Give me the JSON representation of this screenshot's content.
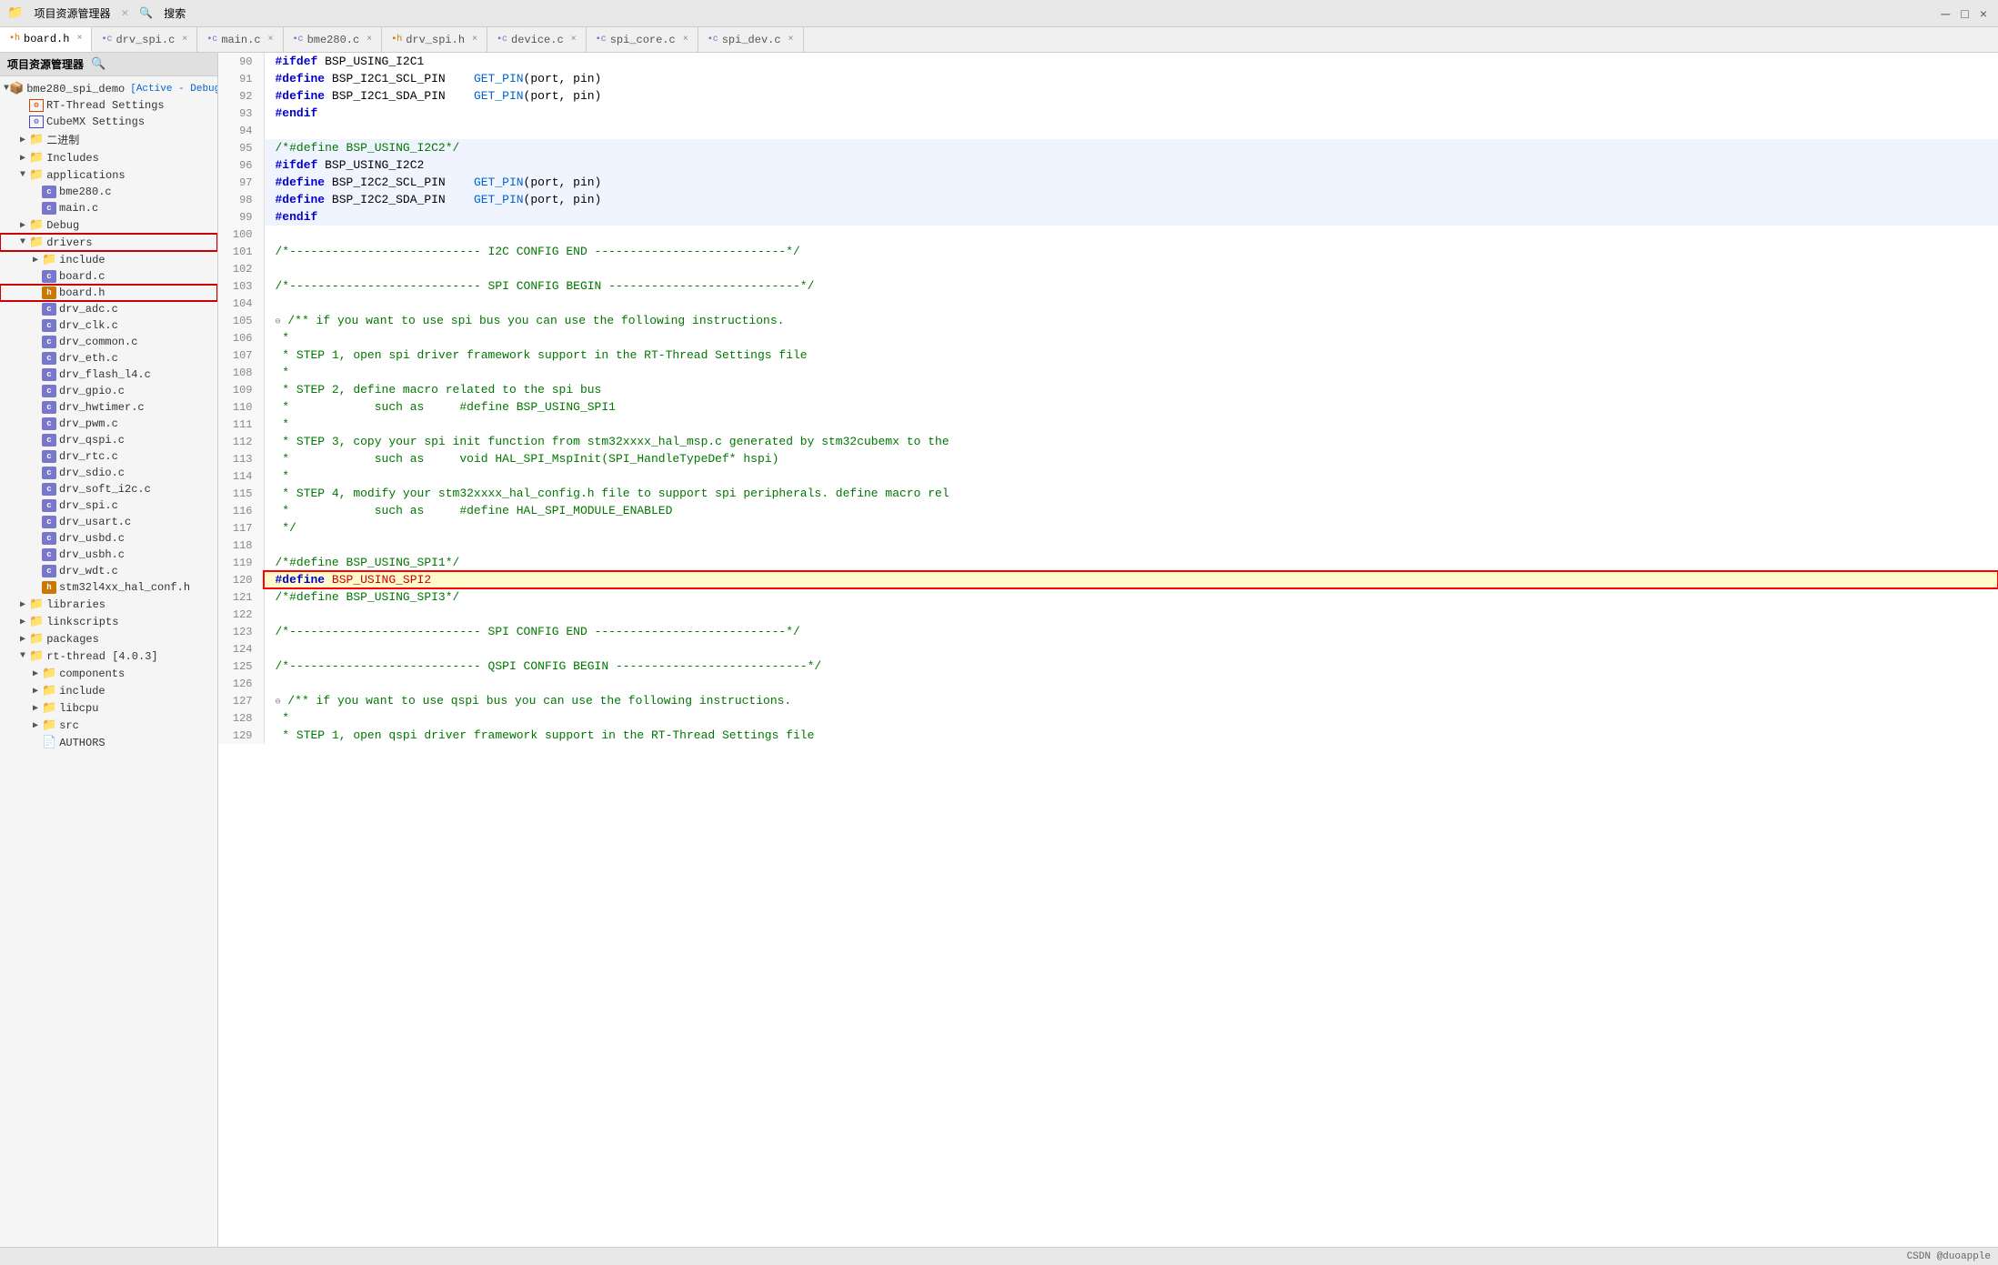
{
  "topbar": {
    "title": "项目资源管理器",
    "search": "搜索",
    "minimize": "─",
    "restore": "□",
    "close": "×",
    "window_controls": [
      "─",
      "□",
      "×"
    ]
  },
  "tabs": [
    {
      "id": "board_h",
      "label": "board.h",
      "icon": "h",
      "active": true,
      "closable": true
    },
    {
      "id": "drv_spi_c",
      "label": "drv_spi.c",
      "icon": "c",
      "active": false,
      "closable": true
    },
    {
      "id": "main_c",
      "label": "main.c",
      "icon": "c",
      "active": false,
      "closable": true
    },
    {
      "id": "bme280_c",
      "label": "bme280.c",
      "icon": "c",
      "active": false,
      "closable": true
    },
    {
      "id": "drv_spi_h",
      "label": "drv_spi.h",
      "icon": "h",
      "active": false,
      "closable": true
    },
    {
      "id": "device_c",
      "label": "device.c",
      "icon": "c",
      "active": false,
      "closable": true
    },
    {
      "id": "spi_core_c",
      "label": "spi_core.c",
      "icon": "c",
      "active": false,
      "closable": true
    },
    {
      "id": "spi_dev_c",
      "label": "spi_dev.c",
      "icon": "c",
      "active": false,
      "closable": true
    }
  ],
  "sidebar": {
    "title": "项目资源管理器",
    "search_label": "搜索",
    "tree": [
      {
        "id": "root",
        "label": "bme280_spi_demo",
        "badge": "[Active - Debug]",
        "level": 0,
        "type": "project",
        "expanded": true
      },
      {
        "id": "rt_settings",
        "label": "RT-Thread Settings",
        "level": 1,
        "type": "settings",
        "icon": "RT"
      },
      {
        "id": "cubemx",
        "label": "CubeMX Settings",
        "level": 1,
        "type": "settings",
        "icon": "MX"
      },
      {
        "id": "binary",
        "label": "二进制",
        "level": 1,
        "type": "folder",
        "expanded": false
      },
      {
        "id": "includes",
        "label": "Includes",
        "level": 1,
        "type": "folder",
        "expanded": false
      },
      {
        "id": "applications",
        "label": "applications",
        "level": 1,
        "type": "folder",
        "expanded": true
      },
      {
        "id": "bme280_c",
        "label": "bme280.c",
        "level": 2,
        "type": "c_file"
      },
      {
        "id": "main_c",
        "label": "main.c",
        "level": 2,
        "type": "c_file"
      },
      {
        "id": "debug",
        "label": "Debug",
        "level": 1,
        "type": "folder",
        "expanded": false
      },
      {
        "id": "drivers",
        "label": "drivers",
        "level": 1,
        "type": "folder",
        "expanded": true,
        "highlighted": true
      },
      {
        "id": "include_folder",
        "label": "include",
        "level": 2,
        "type": "folder",
        "expanded": false
      },
      {
        "id": "board_c",
        "label": "board.c",
        "level": 2,
        "type": "c_file"
      },
      {
        "id": "board_h",
        "label": "board.h",
        "level": 2,
        "type": "h_file",
        "highlighted": true
      },
      {
        "id": "drv_adc_c",
        "label": "drv_adc.c",
        "level": 2,
        "type": "c_file"
      },
      {
        "id": "drv_clk_c",
        "label": "drv_clk.c",
        "level": 2,
        "type": "c_file"
      },
      {
        "id": "drv_common_c",
        "label": "drv_common.c",
        "level": 2,
        "type": "c_file"
      },
      {
        "id": "drv_eth_c",
        "label": "drv_eth.c",
        "level": 2,
        "type": "c_file"
      },
      {
        "id": "drv_flash_l4_c",
        "label": "drv_flash_l4.c",
        "level": 2,
        "type": "c_file"
      },
      {
        "id": "drv_gpio_c",
        "label": "drv_gpio.c",
        "level": 2,
        "type": "c_file"
      },
      {
        "id": "drv_hwtimer_c",
        "label": "drv_hwtimer.c",
        "level": 2,
        "type": "c_file"
      },
      {
        "id": "drv_pwm_c",
        "label": "drv_pwm.c",
        "level": 2,
        "type": "c_file"
      },
      {
        "id": "drv_qspi_c",
        "label": "drv_qspi.c",
        "level": 2,
        "type": "c_file"
      },
      {
        "id": "drv_rtc_c",
        "label": "drv_rtc.c",
        "level": 2,
        "type": "c_file"
      },
      {
        "id": "drv_sdio_c",
        "label": "drv_sdio.c",
        "level": 2,
        "type": "c_file"
      },
      {
        "id": "drv_soft_i2c_c",
        "label": "drv_soft_i2c.c",
        "level": 2,
        "type": "c_file"
      },
      {
        "id": "drv_spi_c",
        "label": "drv_spi.c",
        "level": 2,
        "type": "c_file"
      },
      {
        "id": "drv_usart_c",
        "label": "drv_usart.c",
        "level": 2,
        "type": "c_file"
      },
      {
        "id": "drv_usbd_c",
        "label": "drv_usbd.c",
        "level": 2,
        "type": "c_file"
      },
      {
        "id": "drv_usbh_c",
        "label": "drv_usbh.c",
        "level": 2,
        "type": "c_file"
      },
      {
        "id": "drv_wdt_c",
        "label": "drv_wdt.c",
        "level": 2,
        "type": "c_file"
      },
      {
        "id": "stm32l4xx_hal_conf_h",
        "label": "stm32l4xx_hal_conf.h",
        "level": 2,
        "type": "h_file"
      },
      {
        "id": "libraries",
        "label": "libraries",
        "level": 1,
        "type": "folder",
        "expanded": false
      },
      {
        "id": "linkscripts",
        "label": "linkscripts",
        "level": 1,
        "type": "folder",
        "expanded": false
      },
      {
        "id": "packages",
        "label": "packages",
        "level": 1,
        "type": "folder",
        "expanded": false
      },
      {
        "id": "rt_thread",
        "label": "rt-thread [4.0.3]",
        "level": 1,
        "type": "folder",
        "expanded": true
      },
      {
        "id": "components",
        "label": "components",
        "level": 2,
        "type": "folder",
        "expanded": false
      },
      {
        "id": "include_rt",
        "label": "include",
        "level": 2,
        "type": "folder",
        "expanded": false
      },
      {
        "id": "libcpu",
        "label": "libcpu",
        "level": 2,
        "type": "folder",
        "expanded": false
      },
      {
        "id": "src",
        "label": "src",
        "level": 2,
        "type": "folder",
        "expanded": false
      },
      {
        "id": "authors",
        "label": "AUTHORS",
        "level": 2,
        "type": "file"
      }
    ]
  },
  "code": {
    "lines": [
      {
        "num": 90,
        "content": "#ifdef BSP_USING_I2C1",
        "type": "pp"
      },
      {
        "num": 91,
        "content": "#define BSP_I2C1_SCL_PIN    GET_PIN(port, pin)",
        "type": "pp"
      },
      {
        "num": 92,
        "content": "#define BSP_I2C1_SDA_PIN    GET_PIN(port, pin)",
        "type": "pp"
      },
      {
        "num": 93,
        "content": "#endif",
        "type": "pp"
      },
      {
        "num": 94,
        "content": "",
        "type": "blank"
      },
      {
        "num": 95,
        "content": "/*#define BSP_USING_I2C2*/",
        "type": "comment_pp"
      },
      {
        "num": 96,
        "content": "#ifdef BSP_USING_I2C2",
        "type": "pp"
      },
      {
        "num": 97,
        "content": "#define BSP_I2C2_SCL_PIN    GET_PIN(port, pin)",
        "type": "pp"
      },
      {
        "num": 98,
        "content": "#define BSP_I2C2_SDA_PIN    GET_PIN(port, pin)",
        "type": "pp"
      },
      {
        "num": 99,
        "content": "#endif",
        "type": "pp"
      },
      {
        "num": 100,
        "content": "",
        "type": "blank"
      },
      {
        "num": 101,
        "content": "/*--------------------------- I2C CONFIG END ---------------------------*/",
        "type": "comment"
      },
      {
        "num": 102,
        "content": "",
        "type": "blank"
      },
      {
        "num": 103,
        "content": "/*--------------------------- SPI CONFIG BEGIN ---------------------------*/",
        "type": "comment"
      },
      {
        "num": 104,
        "content": "",
        "type": "blank"
      },
      {
        "num": 105,
        "content": "/** if you want to use spi bus you can use the following instructions.",
        "type": "comment_fold"
      },
      {
        "num": 106,
        "content": " *",
        "type": "comment"
      },
      {
        "num": 107,
        "content": " * STEP 1, open spi driver framework support in the RT-Thread Settings file",
        "type": "comment"
      },
      {
        "num": 108,
        "content": " *",
        "type": "comment"
      },
      {
        "num": 109,
        "content": " * STEP 2, define macro related to the spi bus",
        "type": "comment"
      },
      {
        "num": 110,
        "content": " *            such as     #define BSP_USING_SPI1",
        "type": "comment"
      },
      {
        "num": 111,
        "content": " *",
        "type": "comment"
      },
      {
        "num": 112,
        "content": " * STEP 3, copy your spi init function from stm32xxxx_hal_msp.c generated by stm32cubemx to the",
        "type": "comment"
      },
      {
        "num": 113,
        "content": " *            such as     void HAL_SPI_MspInit(SPI_HandleTypeDef* hspi)",
        "type": "comment"
      },
      {
        "num": 114,
        "content": " *",
        "type": "comment"
      },
      {
        "num": 115,
        "content": " * STEP 4, modify your stm32xxxx_hal_config.h file to support spi peripherals. define macro rel",
        "type": "comment"
      },
      {
        "num": 116,
        "content": " *            such as     #define HAL_SPI_MODULE_ENABLED",
        "type": "comment"
      },
      {
        "num": 117,
        "content": " */",
        "type": "comment"
      },
      {
        "num": 118,
        "content": "",
        "type": "blank"
      },
      {
        "num": 119,
        "content": "/*#define BSP_USING_SPI1*/",
        "type": "comment_pp"
      },
      {
        "num": 120,
        "content": "#define BSP_USING_SPI2",
        "type": "pp_highlighted"
      },
      {
        "num": 121,
        "content": "/*#define BSP_USING_SPI3*/",
        "type": "comment_pp"
      },
      {
        "num": 122,
        "content": "",
        "type": "blank"
      },
      {
        "num": 123,
        "content": "/*--------------------------- SPI CONFIG END ---------------------------*/",
        "type": "comment"
      },
      {
        "num": 124,
        "content": "",
        "type": "blank"
      },
      {
        "num": 125,
        "content": "/*--------------------------- QSPI CONFIG BEGIN ---------------------------*/",
        "type": "comment"
      },
      {
        "num": 126,
        "content": "",
        "type": "blank"
      },
      {
        "num": 127,
        "content": "/** if you want to use qspi bus you can use the following instructions.",
        "type": "comment_fold"
      },
      {
        "num": 128,
        "content": " *",
        "type": "comment"
      },
      {
        "num": 129,
        "content": " * STEP 1, open qspi driver framework support in the RT-Thread Settings file",
        "type": "comment"
      }
    ]
  },
  "statusbar": {
    "watermark": "CSDN @duoapple"
  },
  "colors": {
    "accent": "#0066cc",
    "highlight_bg": "#fffbcc",
    "selected_bg": "#dce8f5",
    "folder_color": "#e8a000",
    "c_file_color": "#7777cc",
    "h_file_color": "#cc7700"
  }
}
